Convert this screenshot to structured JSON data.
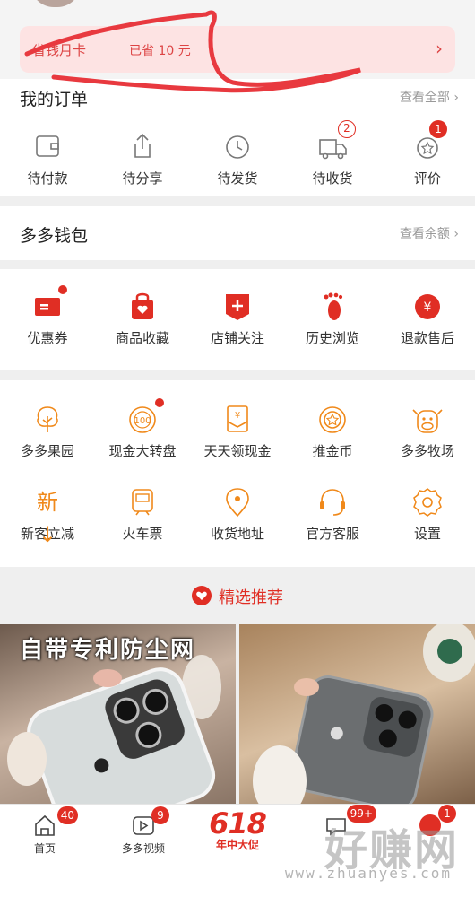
{
  "banner": {
    "title": "省钱月卡",
    "saved": "已省 10 元",
    "chevron": "›"
  },
  "orders": {
    "title": "我的订单",
    "link": "查看全部 ›",
    "items": [
      {
        "label": "待付款",
        "icon": "wallet-icon"
      },
      {
        "label": "待分享",
        "icon": "share-icon"
      },
      {
        "label": "待发货",
        "icon": "clock-icon"
      },
      {
        "label": "待收货",
        "icon": "truck-icon",
        "badge": "2"
      },
      {
        "label": "评价",
        "icon": "review-icon",
        "badge": "1"
      }
    ]
  },
  "wallet": {
    "title": "多多钱包",
    "link": "查看余额 ›"
  },
  "quick": {
    "items": [
      {
        "label": "优惠券",
        "icon": "coupon-icon"
      },
      {
        "label": "商品收藏",
        "icon": "bag-icon"
      },
      {
        "label": "店铺关注",
        "icon": "shop-icon"
      },
      {
        "label": "历史浏览",
        "icon": "footprint-icon"
      },
      {
        "label": "退款售后",
        "icon": "refund-icon"
      }
    ]
  },
  "services": {
    "row1": [
      {
        "label": "多多果园",
        "icon": "tree-icon"
      },
      {
        "label": "现金大转盘",
        "icon": "wheel-icon"
      },
      {
        "label": "天天领现金",
        "icon": "cash-envelope-icon"
      },
      {
        "label": "推金币",
        "icon": "coin-icon"
      },
      {
        "label": "多多牧场",
        "icon": "cow-icon"
      }
    ],
    "row2": [
      {
        "label": "新客立减",
        "icon": "new-customer-icon",
        "glyph": "新↓"
      },
      {
        "label": "火车票",
        "icon": "train-icon"
      },
      {
        "label": "收货地址",
        "icon": "location-icon"
      },
      {
        "label": "官方客服",
        "icon": "headset-icon"
      },
      {
        "label": "设置",
        "icon": "settings-icon"
      }
    ]
  },
  "recommend": {
    "title": "精选推荐"
  },
  "products": [
    {
      "text": "自带专利防尘网"
    },
    {
      "text": ""
    }
  ],
  "tabbar": {
    "home": {
      "label": "首页",
      "badge": "40"
    },
    "video": {
      "label": "多多视频",
      "badge": "9"
    },
    "promo": {
      "big": "618",
      "label": "年中大促"
    },
    "chat": {
      "badge": "99+"
    },
    "me": {
      "badge": "1"
    }
  },
  "watermark": {
    "text": "好赚网",
    "url": "www.zhuanyes.com"
  },
  "colors": {
    "accent": "#e02e24",
    "orange": "#f0891a",
    "banner_bg": "#fde3e3"
  }
}
